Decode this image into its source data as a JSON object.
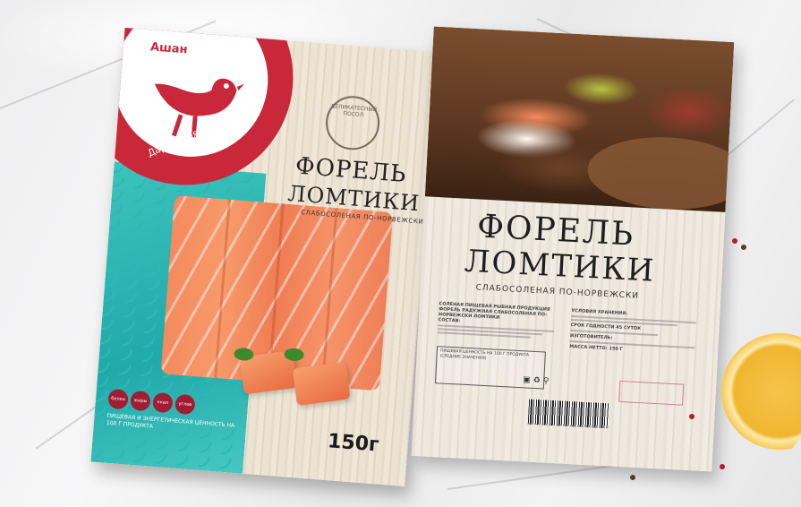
{
  "left_package": {
    "brand": "Ашан",
    "slogan": "Дары моря у вас дома!",
    "stamp": "ДЕЛИКАТЕСНЫЙ ПОСОЛ",
    "title_line1": "ФОРЕЛЬ",
    "title_line2": "ЛОМТИКИ",
    "subtitle": "СЛАБОСОЛЕНАЯ ПО-НОРВЕЖСКИ",
    "nutrition_badges": [
      "белки",
      "жиры",
      "ккал",
      "углев"
    ],
    "energy_note": "ПИЩЕВАЯ И ЭНЕРГЕТИЧЕСКАЯ ЦЕННОСТЬ НА 100 Г ПРОДУКТА",
    "weight": "150г",
    "colors": {
      "brand_red": "#c8283a",
      "wave_teal": "#2fb8b3"
    }
  },
  "right_package": {
    "title_line1": "ФОРЕЛЬ",
    "title_line2": "ЛОМТИКИ",
    "subtitle": "СЛАБОСОЛЕНАЯ ПО-НОРВЕЖСКИ",
    "product_line": "СОЛЕНАЯ ПИЩЕВАЯ РЫБНАЯ ПРОДУКЦИЯ ФОРЕЛЬ РАДУЖНАЯ СЛАБОСОЛЕНАЯ ПО-НОРВЕЖСКИ ЛОМТИКИ",
    "composition_head": "СОСТАВ:",
    "storage_head": "УСЛОВИЯ ХРАНЕНИЯ:",
    "shelf_life_head": "СРОК ГОДНОСТИ 45 СУТОК",
    "manufacturer_head": "ИЗГОТОВИТЕЛЬ:",
    "net_mass": "МАССА НЕТТО: 150 Г",
    "table_head": "ПИЩЕВАЯ ЦЕННОСТЬ НА 100 Г ПРОДУКТА (СРЕДНИЕ ЗНАЧЕНИЯ)"
  }
}
